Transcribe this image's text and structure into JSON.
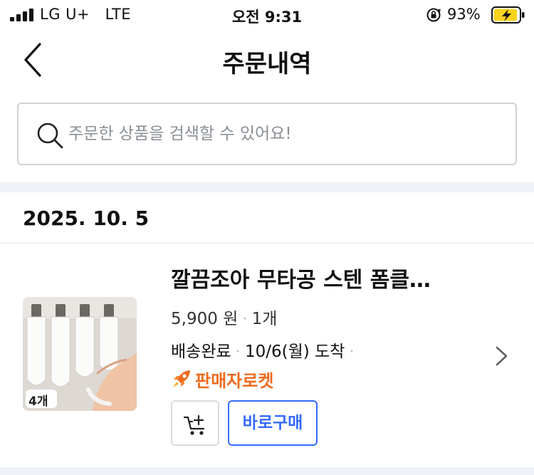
{
  "status_bar": {
    "carrier": "LG U+",
    "network": "LTE",
    "time": "오전 9:31",
    "battery_percent": "93%",
    "battery_level": 0.93
  },
  "header": {
    "title": "주문내역",
    "back_icon": "chevron-left-icon"
  },
  "search": {
    "placeholder": "주문한 상품을 검색할 수 있어요!",
    "value": "",
    "icon": "search-icon"
  },
  "orders": [
    {
      "date": "2025. 10. 5",
      "items": [
        {
          "name": "깔끔조아 무타공 스텐 폼클…",
          "price": "5,900 원",
          "quantity": "1개",
          "delivery_status": "배송완료",
          "arrival": "10/6(월) 도착",
          "badge_label": "판매자로켓",
          "thumbnail_badge": "4개",
          "buy_now_label": "바로구매",
          "cart_icon": "add-to-cart-icon",
          "detail_icon": "chevron-right-icon"
        }
      ]
    }
  ],
  "colors": {
    "accent": "#346aff",
    "rocket": "#ee6a1d",
    "divider": "#eef1f5",
    "battery_fill": "#f7d21e"
  }
}
